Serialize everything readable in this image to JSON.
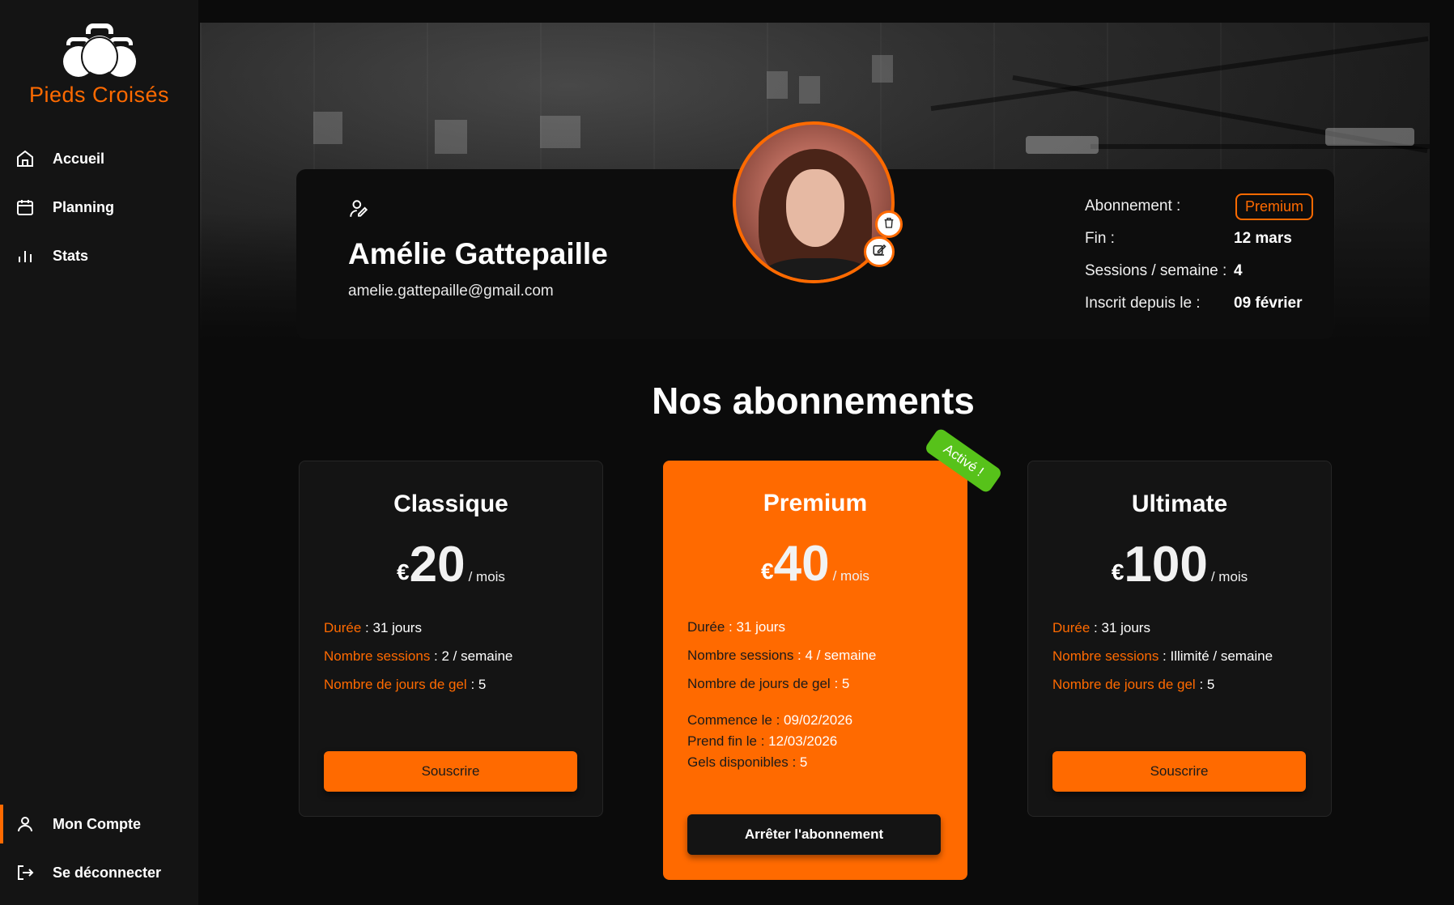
{
  "brand": {
    "name": "Pieds Croisés",
    "accent": "#ff6a00",
    "success": "#57c21a"
  },
  "sidebar": {
    "items": [
      {
        "label": "Accueil",
        "icon": "home-icon"
      },
      {
        "label": "Planning",
        "icon": "calendar-icon"
      },
      {
        "label": "Stats",
        "icon": "bar-chart-icon"
      }
    ],
    "bottom": [
      {
        "label": "Mon Compte",
        "icon": "user-icon",
        "active": true
      },
      {
        "label": "Se déconnecter",
        "icon": "logout-icon"
      }
    ]
  },
  "profile": {
    "name": "Amélie Gattepaille",
    "email": "amelie.gattepaille@gmail.com",
    "subscription_label": "Abonnement :",
    "subscription_value": "Premium",
    "end_label": "Fin :",
    "end_value": "12 mars",
    "sessions_label": "Sessions / semaine :",
    "sessions_value": "4",
    "since_label": "Inscrit depuis le :",
    "since_value": "09 février"
  },
  "section": {
    "title": "Nos abonnements"
  },
  "plans": [
    {
      "name": "Classique",
      "currency": "€",
      "price": "20",
      "period": "/ mois",
      "duration_label": "Durée",
      "duration": "31 jours",
      "sessions_label": "Nombre sessions",
      "sessions": "2 / semaine",
      "freeze_label": "Nombre de jours de gel",
      "freeze": "5",
      "button": "Souscrire"
    },
    {
      "name": "Premium",
      "currency": "€",
      "price": "40",
      "period": "/ mois",
      "duration_label": "Durée",
      "duration": "31 jours",
      "sessions_label": "Nombre sessions",
      "sessions": "4 / semaine",
      "freeze_label": "Nombre de jours de gel",
      "freeze": "5",
      "start_label": "Commence le",
      "start": "09/02/2026",
      "end_label": "Prend fin le",
      "end": "12/03/2026",
      "freezes_label": "Gels disponibles",
      "freezes": "5",
      "badge": "Activé !",
      "button": "Arrêter l'abonnement"
    },
    {
      "name": "Ultimate",
      "currency": "€",
      "price": "100",
      "period": "/ mois",
      "duration_label": "Durée",
      "duration": "31 jours",
      "sessions_label": "Nombre sessions",
      "sessions": "Illimité / semaine",
      "freeze_label": "Nombre de jours de gel",
      "freeze": "5",
      "button": "Souscrire"
    }
  ]
}
